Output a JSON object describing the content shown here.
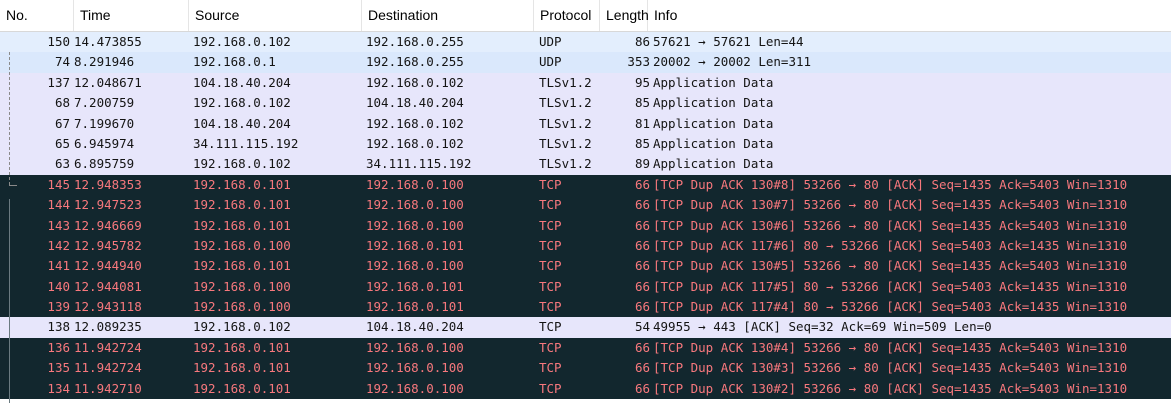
{
  "columns": {
    "no": "No.",
    "time": "Time",
    "source": "Source",
    "destination": "Destination",
    "protocol": "Protocol",
    "length": "Length",
    "info": "Info"
  },
  "sort_indicator": "⌄",
  "packets": [
    {
      "no": "150",
      "time": "14.473855",
      "src": "192.168.0.102",
      "dst": "192.168.0.255",
      "proto": "UDP",
      "len": "86",
      "info": "57621 → 57621 Len=44",
      "style": "udp first"
    },
    {
      "no": "74",
      "time": "8.291946",
      "src": "192.168.0.1",
      "dst": "192.168.0.255",
      "proto": "UDP",
      "len": "353",
      "info": "20002 → 20002 Len=311",
      "style": "udp"
    },
    {
      "no": "137",
      "time": "12.048671",
      "src": "104.18.40.204",
      "dst": "192.168.0.102",
      "proto": "TLSv1.2",
      "len": "95",
      "info": "Application Data",
      "style": "tls"
    },
    {
      "no": "68",
      "time": "7.200759",
      "src": "192.168.0.102",
      "dst": "104.18.40.204",
      "proto": "TLSv1.2",
      "len": "85",
      "info": "Application Data",
      "style": "tls"
    },
    {
      "no": "67",
      "time": "7.199670",
      "src": "104.18.40.204",
      "dst": "192.168.0.102",
      "proto": "TLSv1.2",
      "len": "81",
      "info": "Application Data",
      "style": "tls"
    },
    {
      "no": "65",
      "time": "6.945974",
      "src": "34.111.115.192",
      "dst": "192.168.0.102",
      "proto": "TLSv1.2",
      "len": "85",
      "info": "Application Data",
      "style": "tls"
    },
    {
      "no": "63",
      "time": "6.895759",
      "src": "192.168.0.102",
      "dst": "34.111.115.192",
      "proto": "TLSv1.2",
      "len": "89",
      "info": "Application Data",
      "style": "tls"
    },
    {
      "no": "145",
      "time": "12.948353",
      "src": "192.168.0.101",
      "dst": "192.168.0.100",
      "proto": "TCP",
      "len": "66",
      "info": "[TCP Dup ACK 130#8] 53266 → 80 [ACK] Seq=1435 Ack=5403 Win=1310",
      "style": "bad"
    },
    {
      "no": "144",
      "time": "12.947523",
      "src": "192.168.0.101",
      "dst": "192.168.0.100",
      "proto": "TCP",
      "len": "66",
      "info": "[TCP Dup ACK 130#7] 53266 → 80 [ACK] Seq=1435 Ack=5403 Win=1310",
      "style": "bad"
    },
    {
      "no": "143",
      "time": "12.946669",
      "src": "192.168.0.101",
      "dst": "192.168.0.100",
      "proto": "TCP",
      "len": "66",
      "info": "[TCP Dup ACK 130#6] 53266 → 80 [ACK] Seq=1435 Ack=5403 Win=1310",
      "style": "bad"
    },
    {
      "no": "142",
      "time": "12.945782",
      "src": "192.168.0.100",
      "dst": "192.168.0.101",
      "proto": "TCP",
      "len": "66",
      "info": "[TCP Dup ACK 117#6] 80 → 53266 [ACK] Seq=5403 Ack=1435 Win=1310",
      "style": "bad"
    },
    {
      "no": "141",
      "time": "12.944940",
      "src": "192.168.0.101",
      "dst": "192.168.0.100",
      "proto": "TCP",
      "len": "66",
      "info": "[TCP Dup ACK 130#5] 53266 → 80 [ACK] Seq=1435 Ack=5403 Win=1310",
      "style": "bad"
    },
    {
      "no": "140",
      "time": "12.944081",
      "src": "192.168.0.100",
      "dst": "192.168.0.101",
      "proto": "TCP",
      "len": "66",
      "info": "[TCP Dup ACK 117#5] 80 → 53266 [ACK] Seq=5403 Ack=1435 Win=1310",
      "style": "bad"
    },
    {
      "no": "139",
      "time": "12.943118",
      "src": "192.168.0.100",
      "dst": "192.168.0.101",
      "proto": "TCP",
      "len": "66",
      "info": "[TCP Dup ACK 117#4] 80 → 53266 [ACK] Seq=5403 Ack=1435 Win=1310",
      "style": "bad"
    },
    {
      "no": "138",
      "time": "12.089235",
      "src": "192.168.0.102",
      "dst": "104.18.40.204",
      "proto": "TCP",
      "len": "54",
      "info": "49955 → 443 [ACK] Seq=32 Ack=69 Win=509 Len=0",
      "style": "tcp"
    },
    {
      "no": "136",
      "time": "11.942724",
      "src": "192.168.0.101",
      "dst": "192.168.0.100",
      "proto": "TCP",
      "len": "66",
      "info": "[TCP Dup ACK 130#4] 53266 → 80 [ACK] Seq=1435 Ack=5403 Win=1310",
      "style": "bad"
    },
    {
      "no": "135",
      "time": "11.942724",
      "src": "192.168.0.101",
      "dst": "192.168.0.100",
      "proto": "TCP",
      "len": "66",
      "info": "[TCP Dup ACK 130#3] 53266 → 80 [ACK] Seq=1435 Ack=5403 Win=1310",
      "style": "bad"
    },
    {
      "no": "134",
      "time": "11.942710",
      "src": "192.168.0.101",
      "dst": "192.168.0.100",
      "proto": "TCP",
      "len": "66",
      "info": "[TCP Dup ACK 130#2] 53266 → 80 [ACK] Seq=1435 Ack=5403 Win=1310",
      "style": "bad"
    }
  ],
  "colors": {
    "udp_bg": "#dae8fc",
    "tls_bg": "#e7e6fb",
    "bad_bg": "#12272e",
    "bad_fg": "#f7787d"
  }
}
